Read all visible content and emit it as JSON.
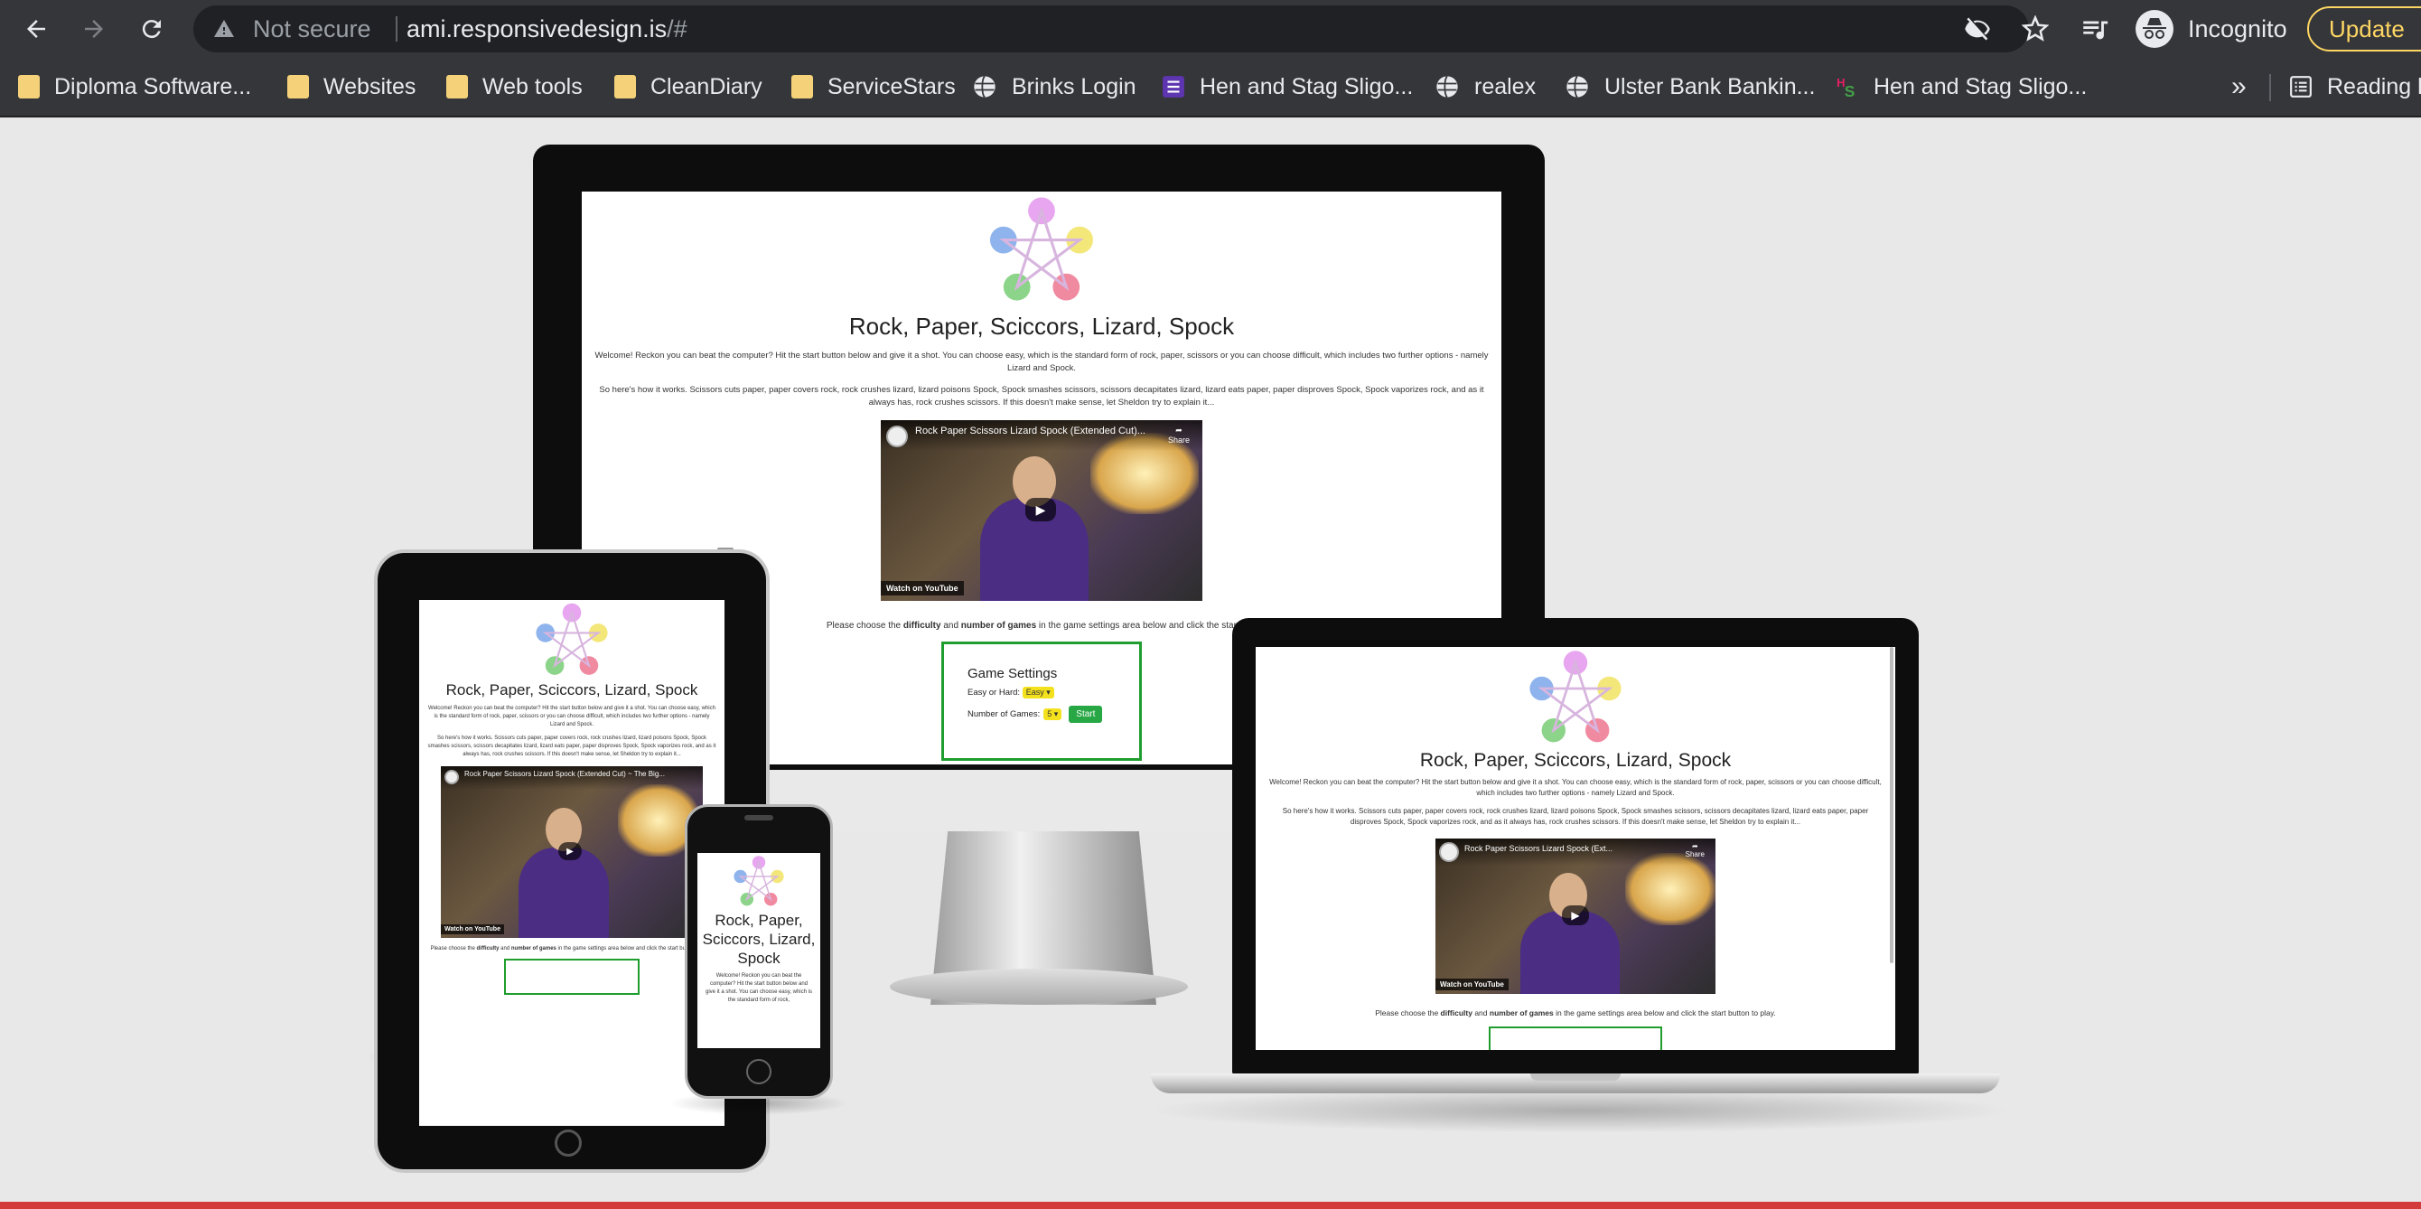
{
  "browser": {
    "omnibox": {
      "security_label": "Not secure",
      "url_host": "ami.responsivedesign.is",
      "url_path": "/#"
    },
    "profile_label": "Incognito",
    "update_label": "Update",
    "bookmarks": [
      {
        "label": "Diploma Software...",
        "icon": "folder-icon"
      },
      {
        "label": "Websites",
        "icon": "folder-icon"
      },
      {
        "label": "Web tools",
        "icon": "folder-icon"
      },
      {
        "label": "CleanDiary",
        "icon": "folder-icon"
      },
      {
        "label": "ServiceStars",
        "icon": "folder-icon"
      },
      {
        "label": "Brinks Login",
        "icon": "globe-icon"
      },
      {
        "label": "Hen and Stag Sligo...",
        "icon": "list-icon"
      },
      {
        "label": "realex",
        "icon": "globe-icon"
      },
      {
        "label": "Ulster Bank Bankin...",
        "icon": "globe-icon"
      },
      {
        "label": "Hen and Stag Sligo...",
        "icon": "hs-icon"
      }
    ],
    "bookmarks_overflow": "»",
    "reading_list_label": "Reading l"
  },
  "site": {
    "title": "Rock, Paper, Sciccors, Lizard, Spock",
    "intro": "Welcome! Reckon you can beat the computer? Hit the start button below and give it a shot. You can choose easy, which is the standard form of rock, paper, scissors or you can choose difficult, which includes two further options - namely Lizard and Spock.",
    "rules": "So here's how it works. Scissors cuts paper, paper covers rock, rock crushes lizard, lizard poisons Spock, Spock smashes scissors, scissors decapitates lizard, lizard eats paper, paper disproves Spock, Spock vaporizes rock, and as it always has, rock crushes scissors. If this doesn't make sense, let Sheldon try to explain it...",
    "video_title_full": "Rock Paper Scissors Lizard Spock (Extended Cut)...",
    "video_title_tablet": "Rock Paper Scissors Lizard Spock (Extended Cut) ~ The Big...",
    "video_title_laptop": "Rock Paper Scissors Lizard Spock (Ext...",
    "watch_on": "Watch on",
    "youtube": "YouTube",
    "share": "Share",
    "watch_later": "Watch later",
    "choose_prefix": "Please choose the ",
    "choose_difficulty": "difficulty",
    "choose_and": " and ",
    "choose_games": "number of games",
    "choose_suffix": " in the game settings area below and click the start button to play.",
    "choose_suffix_cut": " in the game settings area below and click the start butt",
    "settings_title": "Game Settings",
    "difficulty_label": "Easy or Hard:",
    "difficulty_value": "Easy",
    "games_label": "Number of Games:",
    "games_value": "5",
    "start_label": "Start",
    "phone_intro": "Welcome! Reckon you can beat the computer? Hit the start button below and give it a shot. You can choose easy, which is the standard form of rock,"
  },
  "colors": {
    "chrome_bg": "#35363a",
    "omnibox_bg": "#202124",
    "update_accent": "#fdd663",
    "settings_border": "#1f9d2e",
    "select_bg": "#f4e11d",
    "start_bg": "#28a745"
  }
}
